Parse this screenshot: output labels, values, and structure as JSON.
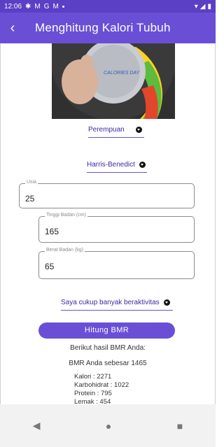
{
  "status": {
    "time": "12:06",
    "icons": [
      "settings-icon",
      "gmail-icon",
      "google-icon",
      "gmail-icon"
    ]
  },
  "header": {
    "title": "Menghitung Kalori Tubuh"
  },
  "hero": {
    "text": "CALORIES DAY"
  },
  "gender": {
    "value": "Perempuan"
  },
  "formula": {
    "value": "Harris-Benedict"
  },
  "fields": {
    "age": {
      "label": "Usia",
      "value": "25"
    },
    "height": {
      "label": "Tinggi Badan (cm)",
      "value": "165"
    },
    "weight": {
      "label": "Berat Badan (kg)",
      "value": "65"
    }
  },
  "activity": {
    "value": "Saya cukup banyak beraktivitas"
  },
  "button": {
    "label": "Hitung BMR"
  },
  "result": {
    "intro": "Berikut hasil BMR Anda:",
    "bmr": "BMR Anda sebesar 1465",
    "kalori": "Kalori : 2271",
    "karbohidrat": "Karbohidrat : 1022",
    "protein": "Protein : 795",
    "lemak": "Lemak : 454"
  },
  "nav": {
    "back_icon": "◀",
    "home_icon": "●",
    "recents_icon": "■"
  }
}
